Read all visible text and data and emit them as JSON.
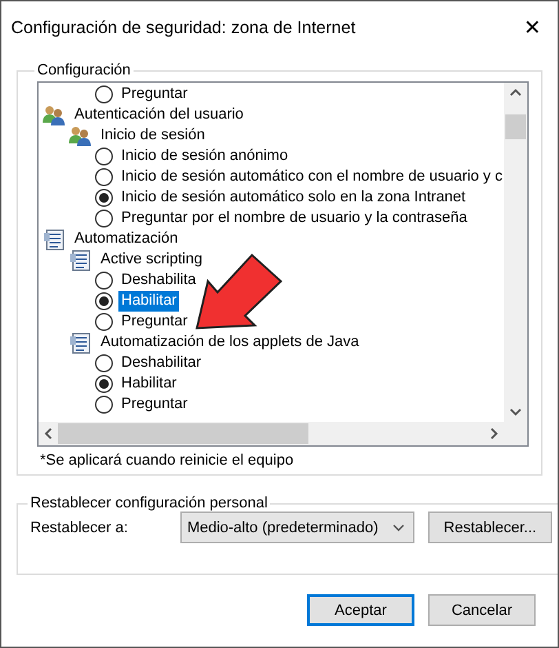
{
  "window": {
    "title": "Configuración de seguridad: zona de Internet",
    "close": "✕"
  },
  "settings": {
    "title": "Configuración",
    "items": [
      {
        "kind": "radio",
        "label": "Preguntar",
        "checked": false,
        "selected": false
      },
      {
        "kind": "users",
        "label": "Autenticación del usuario",
        "children": [
          {
            "kind": "users",
            "label": "Inicio de sesión",
            "children": [
              {
                "kind": "radio",
                "label": "Inicio de sesión anónimo",
                "checked": false,
                "selected": false
              },
              {
                "kind": "radio",
                "label": "Inicio de sesión automático con el nombre de usuario y c",
                "checked": false,
                "selected": false
              },
              {
                "kind": "radio",
                "label": "Inicio de sesión automático solo en la zona Intranet",
                "checked": true,
                "selected": false
              },
              {
                "kind": "radio",
                "label": "Preguntar por el nombre de usuario y la contraseña",
                "checked": false,
                "selected": false
              }
            ]
          }
        ]
      },
      {
        "kind": "script",
        "label": "Automatización",
        "children": [
          {
            "kind": "script",
            "label": "Active scripting",
            "children": [
              {
                "kind": "radio",
                "label": "Deshabilita",
                "checked": false,
                "selected": false
              },
              {
                "kind": "radio",
                "label": "Habilitar",
                "checked": true,
                "selected": true
              },
              {
                "kind": "radio",
                "label": "Preguntar",
                "checked": false,
                "selected": false
              }
            ]
          },
          {
            "kind": "script",
            "label": "Automatización de los applets de Java",
            "children": [
              {
                "kind": "radio",
                "label": "Deshabilitar",
                "checked": false,
                "selected": false
              },
              {
                "kind": "radio",
                "label": "Habilitar",
                "checked": true,
                "selected": false
              },
              {
                "kind": "radio",
                "label": "Preguntar",
                "checked": false,
                "selected": false
              }
            ]
          }
        ]
      }
    ],
    "note": "*Se aplicará cuando reinicie el equipo"
  },
  "reset": {
    "title": "Restablecer configuración personal",
    "label": "Restablecer a:",
    "value": "Medio-alto (predeterminado)",
    "button": "Restablecer..."
  },
  "buttons": [
    {
      "label": "Aceptar",
      "default": true
    },
    {
      "label": "Cancelar",
      "default": false
    }
  ]
}
